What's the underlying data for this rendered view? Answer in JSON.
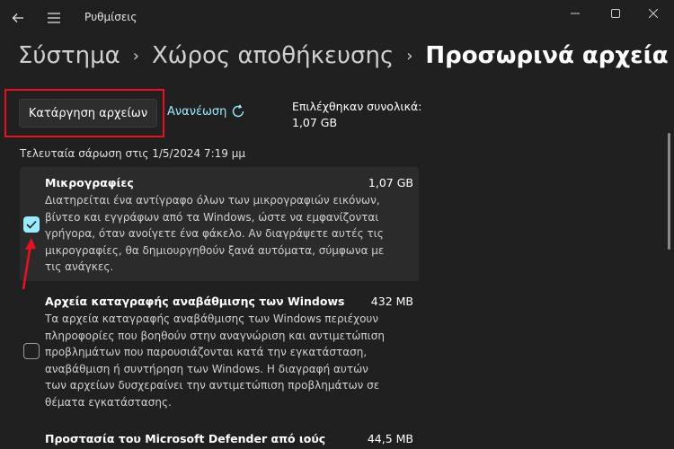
{
  "app": {
    "title": "Ρυθμίσεις"
  },
  "breadcrumb": {
    "items": [
      "Σύστημα",
      "Χώρος αποθήκευσης",
      "Προσωρινά αρχεία"
    ]
  },
  "actions": {
    "remove_label": "Κατάργηση αρχείων",
    "refresh_label": "Ανανέωση",
    "selected_label": "Επιλέχθηκαν συνολικά:",
    "selected_value": "1,07 GB"
  },
  "scan": {
    "last_scan": "Τελευταία σάρωση στις 1/5/2024 7:19 μμ"
  },
  "items": [
    {
      "title": "Μικρογραφίες",
      "size": "1,07 GB",
      "checked": true,
      "desc_lines": [
        "Διατηρείται ένα αντίγραφο όλων των μικρογραφιών εικόνων,",
        "βίντεο και εγγράφων από τα Windows, ώστε να εμφανίζονται",
        "γρήγορα, όταν ανοίγετε ένα φάκελο. Αν διαγράψετε αυτές τις",
        "μικρογραφίες, θα δημιουργηθούν ξανά αυτόματα, σύμφωνα με",
        "τις ανάγκες."
      ]
    },
    {
      "title": "Αρχεία καταγραφής αναβάθμισης των Windows",
      "size": "432 MB",
      "checked": false,
      "desc_lines": [
        "Τα αρχεία καταγραφής αναβάθμισης των Windows περιέχουν",
        "πληροφορίες που βοηθούν στην αναγνώριση και αντιμετώπιση",
        "προβλημάτων που παρουσιάζονται κατά την εγκατάσταση,",
        "αναβάθμιση ή συντήρηση των Windows. Η διαγραφή αυτών",
        "των αρχείων δυσχεραίνει την αντιμετώπιση προβλημάτων σε",
        "θέματα εγκατάστασης."
      ]
    },
    {
      "title": "Προστασία του Microsoft Defender από ιούς",
      "size": "44,5 MB",
      "checked": false,
      "desc_lines": []
    }
  ],
  "colors": {
    "accent": "#99ebff",
    "annotation": "#e81123",
    "background": "#202020"
  },
  "icons": {
    "back": "back-arrow-icon",
    "menu": "hamburger-menu-icon",
    "refresh": "refresh-icon",
    "check": "checkmark-icon"
  }
}
